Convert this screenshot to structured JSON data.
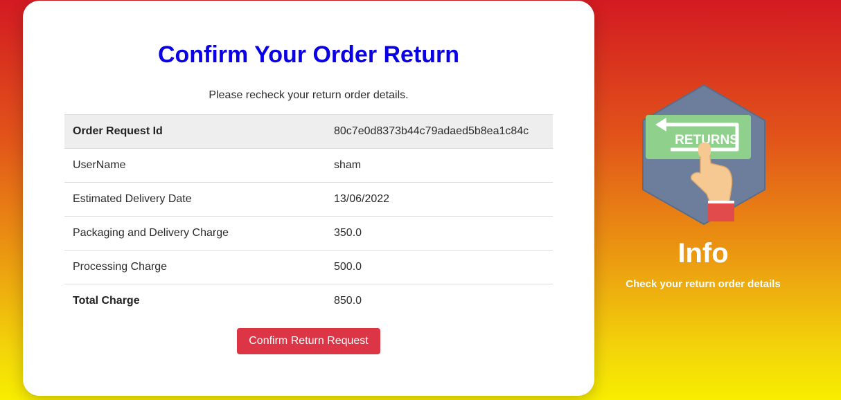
{
  "confirm_card": {
    "title": "Confirm Your Order Return",
    "subtitle": "Please recheck your return order details.",
    "rows": [
      {
        "label": "Order Request Id",
        "value": "80c7e0d8373b44c79adaed5b8ea1c84c"
      },
      {
        "label": "UserName",
        "value": "sham"
      },
      {
        "label": "Estimated Delivery Date",
        "value": "13/06/2022"
      },
      {
        "label": "Packaging and Delivery Charge",
        "value": "350.0"
      },
      {
        "label": "Processing Charge",
        "value": "500.0"
      },
      {
        "label": "Total Charge",
        "value": "850.0"
      }
    ],
    "confirm_button_label": "Confirm Return Request"
  },
  "info_panel": {
    "illustration_icon": "returns-icon",
    "illustration_text": "RETURNS",
    "title": "Info",
    "subtitle": "Check your return order details"
  },
  "colors": {
    "title": "#0a00e6",
    "button": "#dc3545",
    "gradient_top": "#d31a22",
    "gradient_bottom": "#f8ee00"
  }
}
